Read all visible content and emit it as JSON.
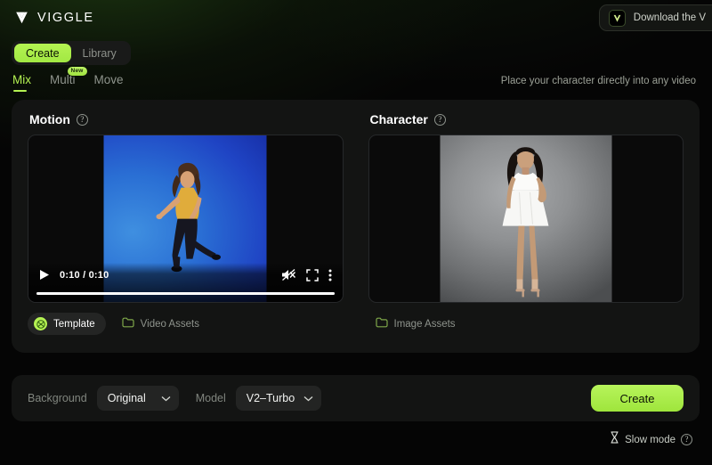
{
  "brand": {
    "name": "VIGGLE",
    "logo_icon": "viggle-v-logo-icon"
  },
  "topbar": {
    "download": {
      "label": "Download the V",
      "icon": "viggle-app-icon"
    }
  },
  "segment": {
    "items": [
      {
        "label": "Create",
        "active": true
      },
      {
        "label": "Library",
        "active": false
      }
    ]
  },
  "tabs": {
    "items": [
      {
        "label": "Mix",
        "active": true,
        "badge": ""
      },
      {
        "label": "Multi",
        "active": false,
        "badge": "New"
      },
      {
        "label": "Move",
        "active": false,
        "badge": ""
      }
    ],
    "tagline": "Place your character directly into any video"
  },
  "motion_panel": {
    "title": "Motion",
    "help_icon": "question-circle-icon",
    "player": {
      "play_icon": "play-icon",
      "time": "0:10 / 0:10",
      "mute_icon": "volume-muted-icon",
      "fullscreen_icon": "fullscreen-icon",
      "more_icon": "more-vertical-icon",
      "progress_percent": 100
    },
    "assets": {
      "template_label": "Template",
      "template_icon": "template-grid-icon",
      "video_assets_label": "Video Assets",
      "video_assets_icon": "folder-icon"
    }
  },
  "character_panel": {
    "title": "Character",
    "help_icon": "question-circle-icon",
    "assets": {
      "image_assets_label": "Image Assets",
      "image_assets_icon": "folder-icon"
    }
  },
  "bottom_bar": {
    "background_label": "Background",
    "background_value": "Original",
    "model_label": "Model",
    "model_value": "V2–Turbo",
    "chevron_icon": "chevron-down-icon",
    "create_label": "Create"
  },
  "slow_mode": {
    "label": "Slow mode",
    "icon": "hourglass-icon",
    "help_icon": "question-circle-icon"
  },
  "colors": {
    "accent_green": "#b4f252",
    "card_bg": "#131413",
    "page_bg": "#050505",
    "text_muted": "#8e938c"
  }
}
